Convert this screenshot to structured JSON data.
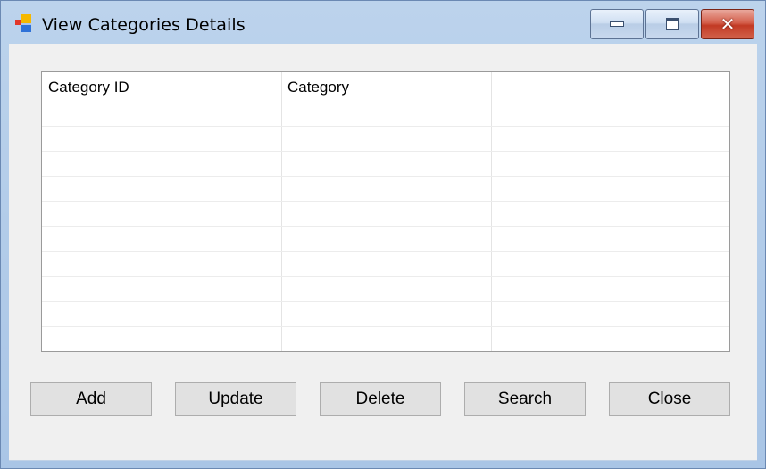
{
  "window": {
    "title": "View Categories Details",
    "icon": "app-window-icon",
    "controls": {
      "minimize_icon": "minimize-icon",
      "maximize_icon": "maximize-icon",
      "close_glyph": "✕"
    },
    "colors": {
      "frame": "#b7cfeb",
      "close_button": "#c94a35",
      "client_background": "#f0f0f0"
    }
  },
  "grid": {
    "columns": [
      "Category ID",
      "Category"
    ]
  },
  "buttons": {
    "add": "Add",
    "update": "Update",
    "delete": "Delete",
    "search": "Search",
    "close": "Close"
  }
}
